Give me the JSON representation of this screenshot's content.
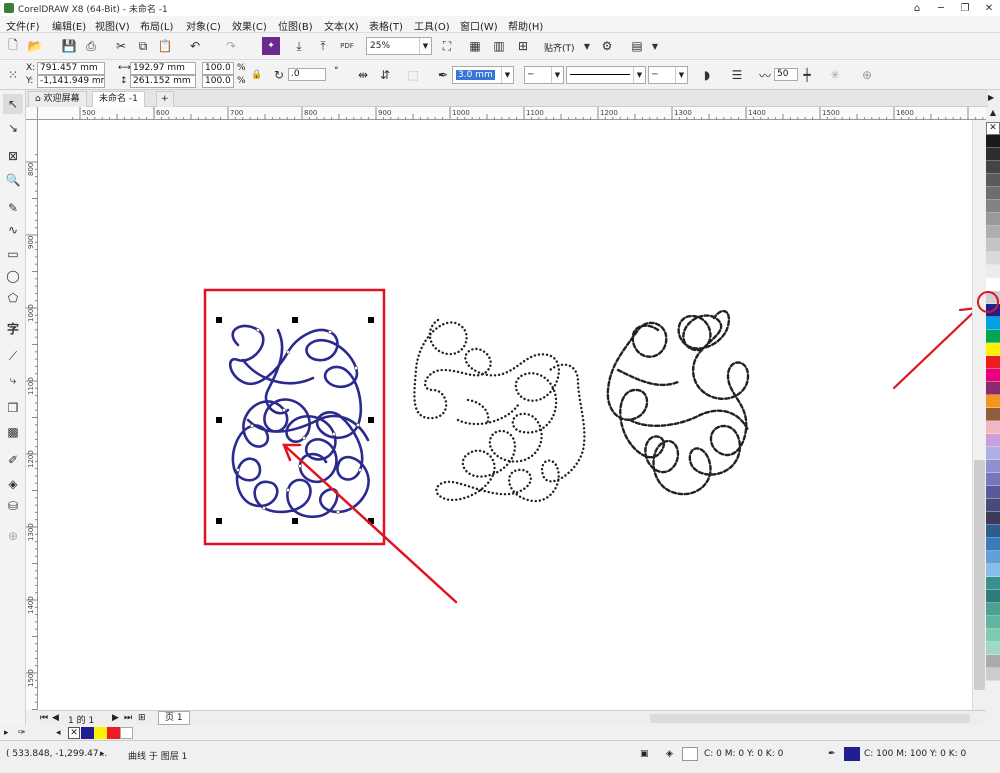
{
  "title": "CorelDRAW X8 (64-Bit) - 未命名 -1",
  "menu": [
    "文件(F)",
    "编辑(E)",
    "视图(V)",
    "布局(L)",
    "对象(C)",
    "效果(C)",
    "位图(B)",
    "文本(X)",
    "表格(T)",
    "工具(O)",
    "窗口(W)",
    "帮助(H)"
  ],
  "toolbar": {
    "zoom": "25%",
    "snap_label": "贴齐(T)",
    "pdf_label": "PDF"
  },
  "property_bar": {
    "x": "791.457 mm",
    "y": "-1,141.949 mm",
    "width": "192.97 mm",
    "height": "261.152 mm",
    "scale_x": "100.0",
    "scale_y": "100.0",
    "percent": "%",
    "rotation": ".0",
    "degree": "°",
    "outline_width": "3.0 mm",
    "smoothing": "50"
  },
  "tabs": {
    "welcome": "欢迎屏幕",
    "document": "未命名 -1"
  },
  "ruler_h": [
    "500",
    "600",
    "700",
    "800",
    "900",
    "1000",
    "1100",
    "1200",
    "1300",
    "1400",
    "1500",
    "1600"
  ],
  "ruler_v": [
    "800",
    "900",
    "1000",
    "1100",
    "1200",
    "1300",
    "1400",
    "1500"
  ],
  "page_nav": {
    "page_count": "1 的 1",
    "page_tab": "页 1"
  },
  "status": {
    "cursor": "( 533.848, -1,299.47...",
    "object_info": "曲线 于 图层 1",
    "fill_info": "C: 0 M: 0 Y: 0 K: 0",
    "outline_info": "C: 100 M: 100 Y: 0 K: 0"
  },
  "colors": {
    "selected_outline": "#2a2a8f",
    "annotation_red": "#e0141e",
    "palette": [
      "#ffffff",
      "#1a1a1a",
      "#2e2e2e",
      "#444444",
      "#5a5a5a",
      "#6e6e6e",
      "#838383",
      "#999999",
      "#aeaeae",
      "#c4c4c4",
      "#d9d9d9",
      "#ececec",
      "#ffffff",
      "#cfcfcf",
      "#1f1f8f",
      "#00a3e0",
      "#00a651",
      "#fff200",
      "#ed1c24",
      "#e6007e",
      "#8b2a6e",
      "#f7941d",
      "#8c5e3c",
      "#f4b6c2",
      "#c9a0dc",
      "#b0b0e0",
      "#9090d0",
      "#7575c0",
      "#5a5a9a",
      "#4a4a7a",
      "#3a3a5a",
      "#2c5d8f",
      "#3a7ab8",
      "#5fa0d8",
      "#88bde8",
      "#3a8f8f",
      "#2f7a7a",
      "#4d9f8f",
      "#5fb59f",
      "#7fc9b5",
      "#9fd8c9",
      "#aaaaaa",
      "#cccccc"
    ]
  }
}
